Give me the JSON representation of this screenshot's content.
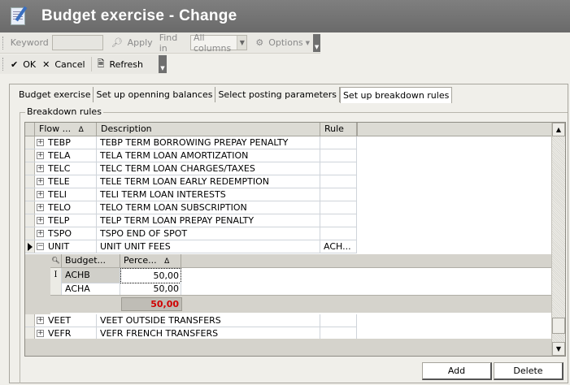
{
  "window": {
    "title": "Budget exercise - Change",
    "icon": "document-edit-icon"
  },
  "toolbar": {
    "keyword_label": "Keyword",
    "keyword_value": "",
    "apply_label": "Apply",
    "find_in_label": "Find in",
    "find_in_value": "All columns",
    "options_label": "Options",
    "ok_label": "OK",
    "cancel_label": "Cancel",
    "refresh_label": "Refresh"
  },
  "tabs": [
    {
      "label": "Budget exercise"
    },
    {
      "label": "Set up openning balances"
    },
    {
      "label": "Select posting parameters"
    },
    {
      "label": "Set up breakdown rules",
      "selected": true
    }
  ],
  "breakdown": {
    "group_title": "Breakdown rules",
    "columns": {
      "flow": "Flow ...",
      "description": "Description",
      "rule": "Rule"
    },
    "rows": [
      {
        "flow": "TEBP",
        "description": "TEBP TERM BORROWING PREPAY PENALTY",
        "rule": ""
      },
      {
        "flow": "TELA",
        "description": "TELA TERM LOAN AMORTIZATION",
        "rule": ""
      },
      {
        "flow": "TELC",
        "description": "TELC TERM LOAN CHARGES/TAXES",
        "rule": ""
      },
      {
        "flow": "TELE",
        "description": "TELE TERM LOAN EARLY REDEMPTION",
        "rule": ""
      },
      {
        "flow": "TELI",
        "description": "TELI TERM LOAN INTERESTS",
        "rule": ""
      },
      {
        "flow": "TELO",
        "description": "TELO TERM LOAN SUBSCRIPTION",
        "rule": ""
      },
      {
        "flow": "TELP",
        "description": "TELP TERM LOAN PREPAY PENALTY",
        "rule": ""
      },
      {
        "flow": "TSPO",
        "description": "TSPO END OF SPOT",
        "rule": ""
      },
      {
        "flow": "UNIT",
        "description": "UNIT UNIT FEES",
        "rule": "ACH...",
        "expanded": true,
        "current": true
      }
    ],
    "rows_after": [
      {
        "flow": "VEET",
        "description": "VEET OUTSIDE TRANSFERS",
        "rule": ""
      },
      {
        "flow": "VEFR",
        "description": "VEFR FRENCH TRANSFERS",
        "rule": ""
      }
    ],
    "child": {
      "columns": {
        "budget": "Budget...",
        "percent": "Perce..."
      },
      "rows": [
        {
          "budget": "ACHB",
          "percent": "50,00",
          "selected": true
        },
        {
          "budget": "ACHA",
          "percent": "50,00"
        }
      ],
      "total": "50,00"
    }
  },
  "buttons": {
    "add": "Add",
    "delete": "Delete"
  },
  "colors": {
    "title_bar": "#6f6f6f",
    "total_text": "#d00000"
  }
}
